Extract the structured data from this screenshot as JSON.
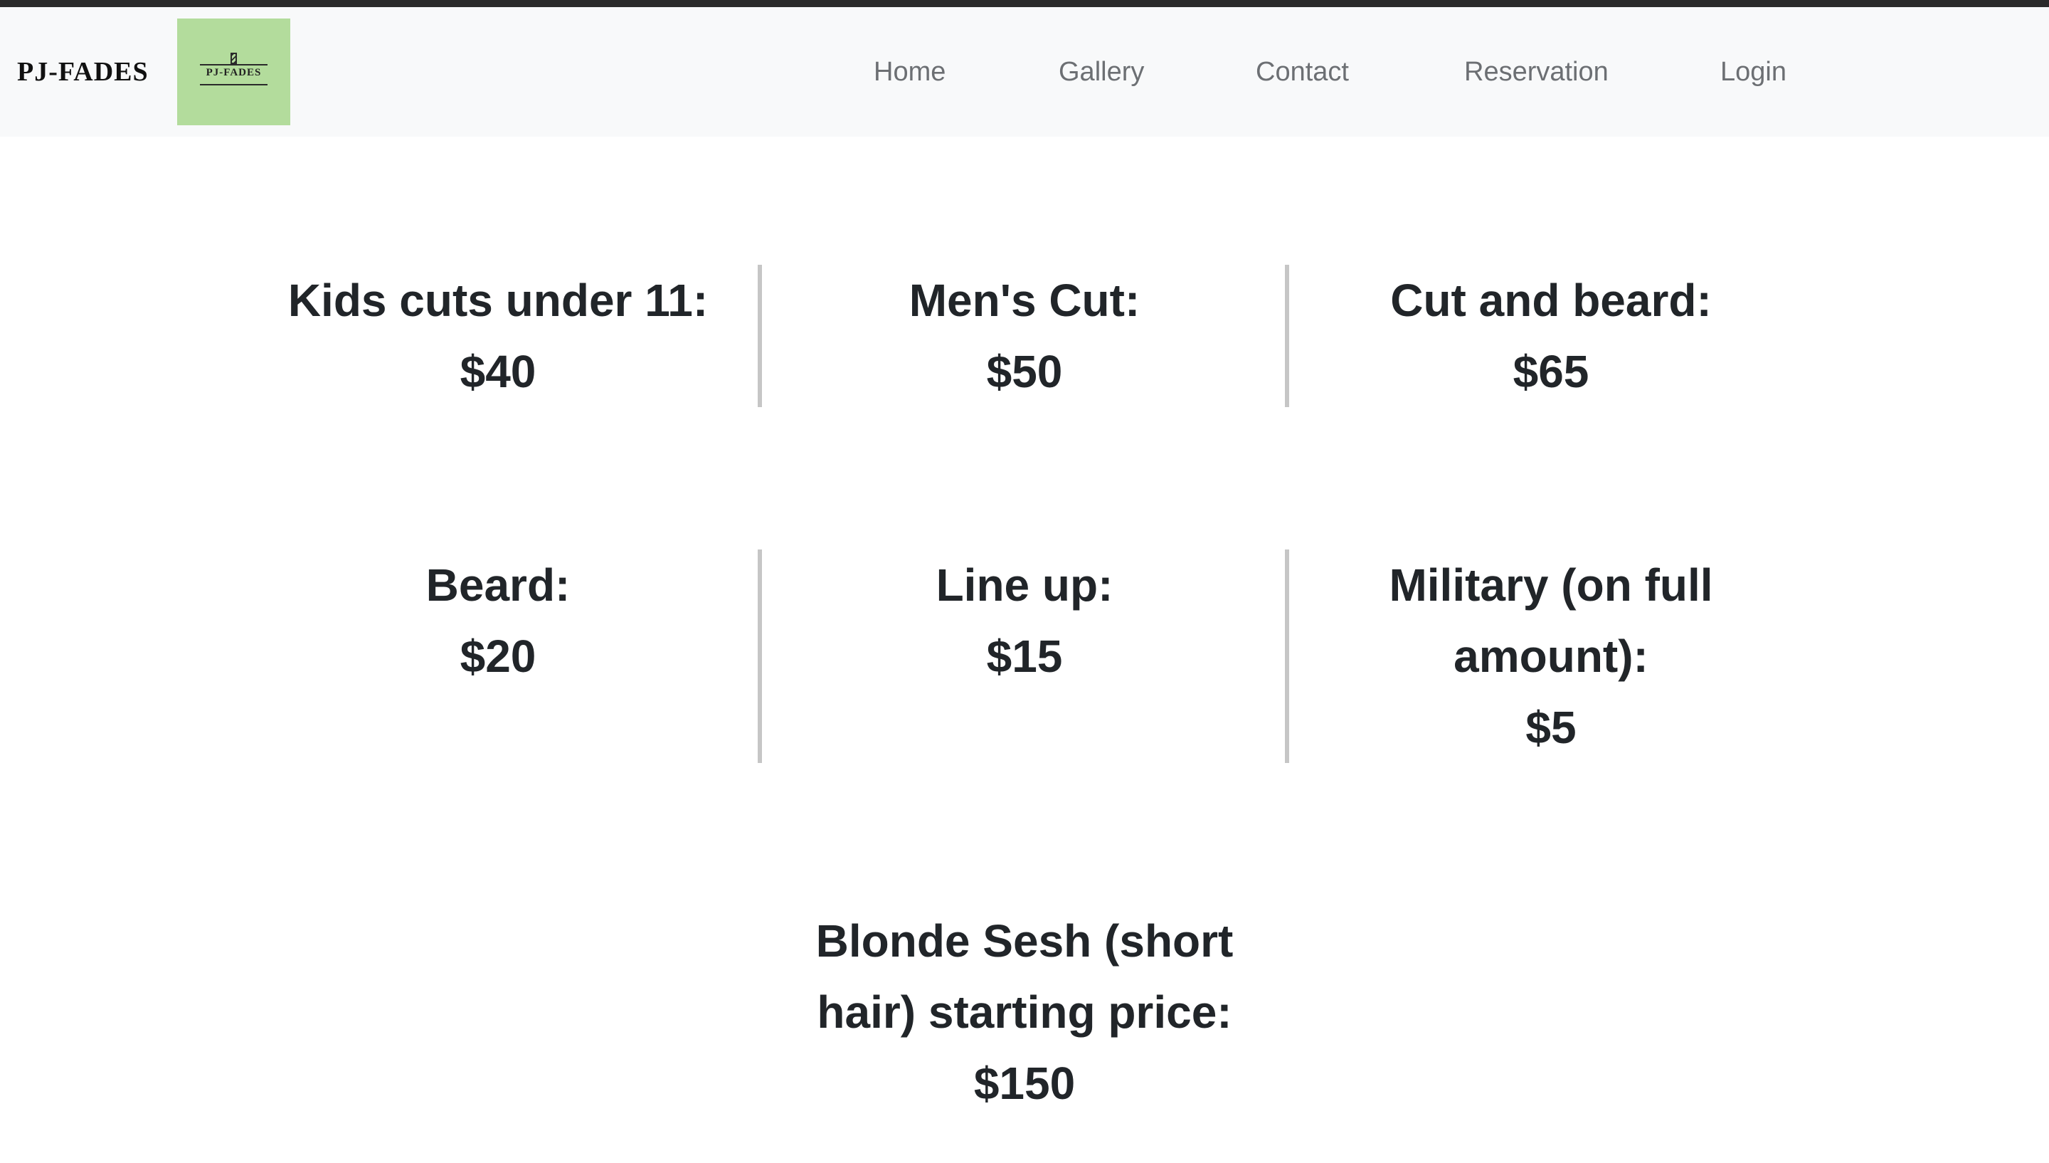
{
  "navbar": {
    "brand": "PJ-FADES",
    "logo_text": "PJ-FADES",
    "links": [
      "Home",
      "Gallery",
      "Contact",
      "Reservation",
      "Login"
    ]
  },
  "pricing": {
    "row1": [
      {
        "title": "Kids cuts under 11:",
        "price": "$40"
      },
      {
        "title": "Men's Cut:",
        "price": "$50"
      },
      {
        "title": "Cut and beard:",
        "price": "$65"
      }
    ],
    "row2": [
      {
        "title": "Beard:",
        "price": "$20"
      },
      {
        "title": "Line up:",
        "price": "$15"
      },
      {
        "title": "Military (on full amount):",
        "price": "$5"
      }
    ],
    "special": {
      "title": "Blonde Sesh (short hair) starting price:",
      "price": "$150"
    }
  },
  "colors": {
    "navbar_bg": "#f8f9fa",
    "logo_bg": "#b3dc9c",
    "text": "#212529",
    "nav_text": "#6c6f73",
    "divider": "#c6c6c6"
  }
}
